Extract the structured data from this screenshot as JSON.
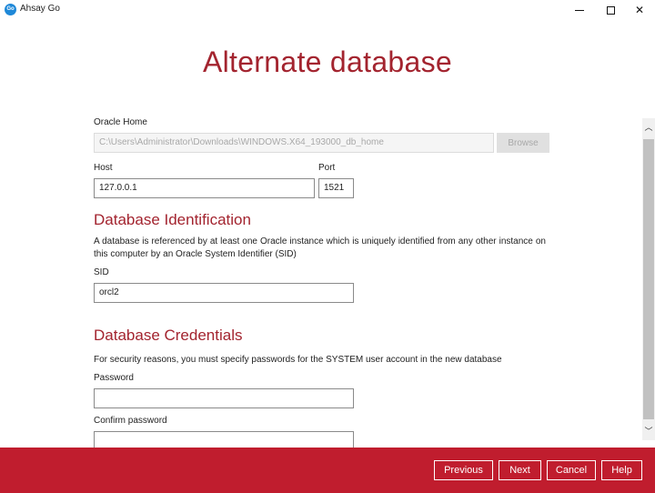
{
  "window": {
    "app_icon_text": "Go",
    "title": "Ahsay Go",
    "minimize_glyph": "",
    "close_glyph": "✕"
  },
  "page": {
    "heading": "Alternate database"
  },
  "oracle_home": {
    "label": "Oracle Home",
    "value": "C:\\Users\\Administrator\\Downloads\\WINDOWS.X64_193000_db_home",
    "browse_label": "Browse"
  },
  "host": {
    "label": "Host",
    "value": "127.0.0.1"
  },
  "port": {
    "label": "Port",
    "value": "1521"
  },
  "db_identification": {
    "title": "Database Identification",
    "description": "A database is referenced by at least one Oracle instance which is uniquely identified from any other instance on this computer by an Oracle System Identifier (SID)",
    "sid_label": "SID",
    "sid_value": "orcl2"
  },
  "db_credentials": {
    "title": "Database Credentials",
    "description": "For security reasons, you must specify passwords for the SYSTEM user account in the new database",
    "password_label": "Password",
    "password_value": "",
    "confirm_label": "Confirm password",
    "confirm_value": ""
  },
  "scrollbar": {
    "up_glyph": "︿",
    "down_glyph": "﹀"
  },
  "footer": {
    "previous_label": "Previous",
    "next_label": "Next",
    "cancel_label": "Cancel",
    "help_label": "Help"
  },
  "colors": {
    "accent": "#a3242f",
    "footer_bg": "#c01d2e"
  }
}
